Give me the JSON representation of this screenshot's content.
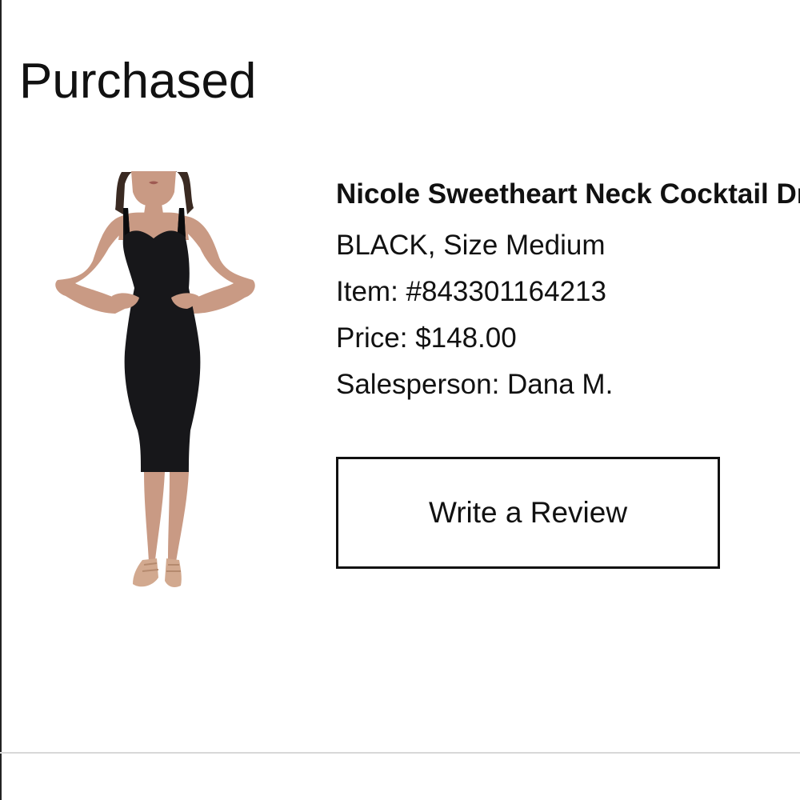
{
  "section": {
    "title": "Purchased"
  },
  "product": {
    "image_alt": "Woman wearing a black sweetheart neck midi cocktail dress with nude strappy sandals",
    "name": "Nicole Sweetheart Neck Cocktail Dress",
    "variant": "BLACK, Size Medium",
    "item": "Item: #843301164213",
    "price": "Price: $148.00",
    "salesperson": "Salesperson: Dana M."
  },
  "actions": {
    "write_review_label": "Write a Review"
  },
  "colors": {
    "text": "#111111",
    "dress": "#17171a",
    "skin": "#c99a84",
    "hair": "#3a2a22",
    "divider": "#d8d8d8"
  }
}
